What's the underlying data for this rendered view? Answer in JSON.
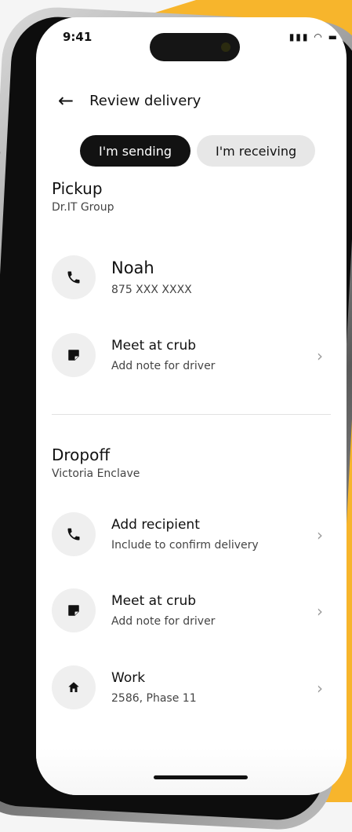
{
  "status_bar": {
    "time": "9:41"
  },
  "header": {
    "title": "Review delivery"
  },
  "segmented": {
    "sending": "I'm sending",
    "receiving": "I'm receiving"
  },
  "pickup": {
    "title": "Pickup",
    "subtitle": "Dr.IT Group",
    "contact": {
      "name": "Noah",
      "phone": "875 XXX XXXX",
      "icon": "phone-icon"
    },
    "note": {
      "title": "Meet at crub",
      "subtitle": "Add note for driver",
      "icon": "note-icon"
    }
  },
  "dropoff": {
    "title": "Dropoff",
    "subtitle": "Victoria Enclave",
    "recipient": {
      "title": "Add recipient",
      "subtitle": "Include to confirm delivery",
      "icon": "phone-icon"
    },
    "note": {
      "title": "Meet at crub",
      "subtitle": "Add note for driver",
      "icon": "note-icon"
    },
    "address": {
      "title": "Work",
      "subtitle": "2586, Phase 11",
      "icon": "home-icon"
    }
  },
  "colors": {
    "accent_yellow": "#f7b52c",
    "active_pill": "#121212",
    "inactive_pill": "#e7e7e7"
  }
}
